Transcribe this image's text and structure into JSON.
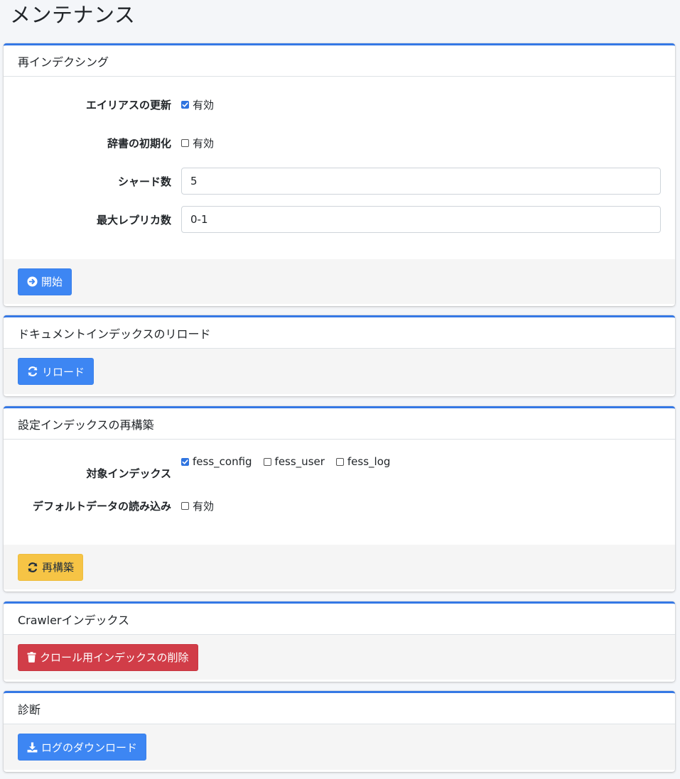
{
  "page": {
    "title": "メンテナンス"
  },
  "reindex": {
    "header": "再インデクシング",
    "alias_label": "エイリアスの更新",
    "alias_option": "有効",
    "alias_checked": true,
    "dict_label": "辞書の初期化",
    "dict_option": "有効",
    "dict_checked": false,
    "shards_label": "シャード数",
    "shards_value": "5",
    "replicas_label": "最大レプリカ数",
    "replicas_value": "0-1",
    "start_button": "開始"
  },
  "reload": {
    "header": "ドキュメントインデックスのリロード",
    "button": "リロード"
  },
  "config_rebuild": {
    "header": "設定インデックスの再構築",
    "target_label": "対象インデックス",
    "targets": [
      {
        "name": "fess_config",
        "checked": true
      },
      {
        "name": "fess_user",
        "checked": false
      },
      {
        "name": "fess_log",
        "checked": false
      }
    ],
    "default_label": "デフォルトデータの読み込み",
    "default_option": "有効",
    "default_checked": false,
    "button": "再構築"
  },
  "crawler": {
    "header": "Crawlerインデックス",
    "button": "クロール用インデックスの削除"
  },
  "diagnosis": {
    "header": "診断",
    "button": "ログのダウンロード"
  },
  "colors": {
    "accent": "#3578e5",
    "primary_button": "#3d86f3",
    "warning_button": "#f6c445",
    "danger_button": "#d13d48",
    "background": "#f4f6f9"
  },
  "icons": {
    "start": "arrow-circle-right-icon",
    "reload": "sync-icon",
    "rebuild": "sync-icon",
    "delete": "trash-icon",
    "download": "download-icon"
  }
}
